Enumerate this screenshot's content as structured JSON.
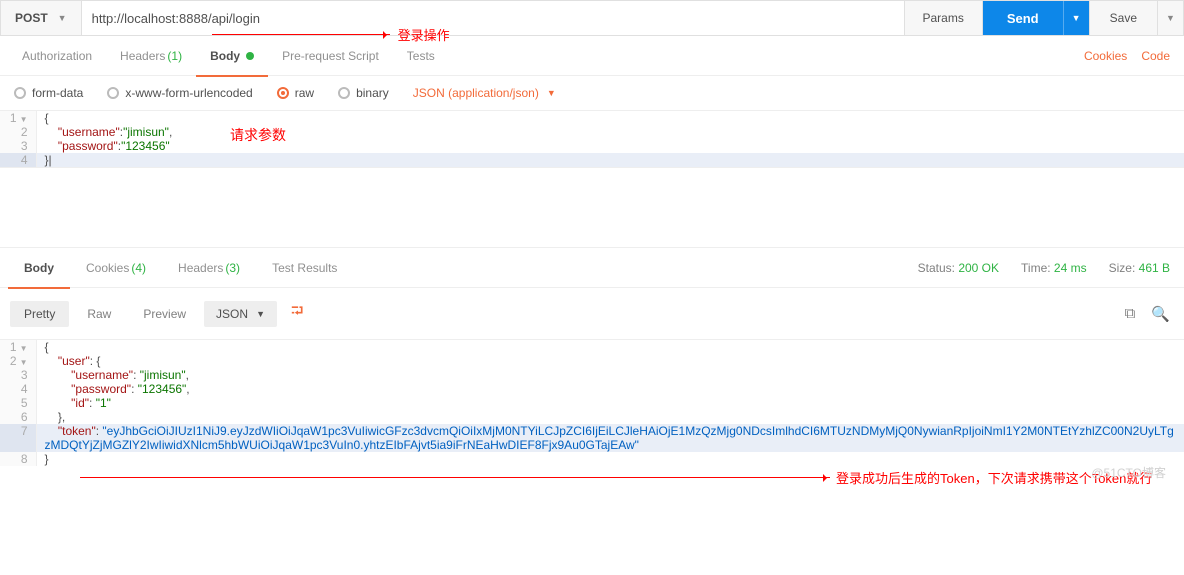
{
  "request": {
    "method": "POST",
    "url": "http://localhost:8888/api/login",
    "params_btn": "Params",
    "send_btn": "Send",
    "save_btn": "Save"
  },
  "req_tabs": {
    "auth": "Authorization",
    "headers": "Headers",
    "headers_count": "(1)",
    "body": "Body",
    "prs": "Pre-request Script",
    "tests": "Tests"
  },
  "right_links": {
    "cookies": "Cookies",
    "code": "Code"
  },
  "body_types": {
    "form": "form-data",
    "urlenc": "x-www-form-urlencoded",
    "raw": "raw",
    "binary": "binary",
    "json_dd": "JSON (application/json)"
  },
  "req_body": {
    "lines": [
      "{",
      "    \"username\":\"jimisun\",",
      "    \"password\":\"123456\"",
      "}"
    ],
    "line1": "{",
    "line2_key": "\"username\"",
    "line2_val": "\"jimisun\"",
    "line2_suffix": ",",
    "line3_key": "\"password\"",
    "line3_val": "\"123456\"",
    "line4": "}"
  },
  "annotations": {
    "login": "登录操作",
    "params": "请求参数",
    "token": "登录成功后生成的Token，下次请求携带这个Token就行"
  },
  "resp_tabs": {
    "body": "Body",
    "cookies": "Cookies",
    "cookies_count": "(4)",
    "headers": "Headers",
    "headers_count": "(3)",
    "tests": "Test Results"
  },
  "status": {
    "status_label": "Status:",
    "status_val": "200 OK",
    "time_label": "Time:",
    "time_val": "24 ms",
    "size_label": "Size:",
    "size_val": "461 B"
  },
  "toolbar": {
    "pretty": "Pretty",
    "raw": "Raw",
    "preview": "Preview",
    "json": "JSON"
  },
  "resp_body": {
    "line1": "{",
    "line2_key": "\"user\"",
    "line2_rest": ": {",
    "line3_key": "\"username\"",
    "line3_val": "\"jimisun\"",
    "comma": ",",
    "line4_key": "\"password\"",
    "line4_val": "\"123456\"",
    "line5_key": "\"id\"",
    "line5_val": "\"1\"",
    "line6": "},",
    "line7_key": "\"token\"",
    "line7_colon": ": ",
    "line7_val": "\"eyJhbGciOiJIUzI1NiJ9.eyJzdWIiOiJqaW1pc3VuIiwicGFzc3dvcmQiOiIxMjM0NTYiLCJpZCI6IjEiLCJleHAiOjE1MzQzMjg0NDcsImlhdCI6MTUzNDMyMjQ0NywianRpIjoiNmI1Y2M0NTEtYzhlZC00N2UyLTgzMDQtYjZjMGZlY2IwIiwidXNlcm5hbWUiOiJqaW1pc3VuIn0.yhtzEIbFAjvt5ia9iFrNEaHwDIEF8Fjx9Au0GTajEAw\"",
    "line8": "}"
  },
  "chart_data": {
    "request_body_json": {
      "username": "jimisun",
      "password": "123456"
    },
    "response_body_json": {
      "user": {
        "username": "jimisun",
        "password": "123456",
        "id": "1"
      },
      "token": "eyJhbGciOiJIUzI1NiJ9.eyJzdWIiOiJqaW1pc3VuIiwicGFzc3dvcmQiOiIxMjM0NTYiLCJpZCI6IjEiLCJleHAiOjE1MzQzMjg0NDcsImlhdCI6MTUzNDMyMjQ0NywianRpIjoiNmI1Y2M0NTEtYzhlZC00N2UyLTgzMDQtYjZjMGZlY2IwIiwidXNlcm5hbWUiOiJqaW1pc3VuIn0.yhtzEIbFAjvt5ia9iFrNEaHwDIEF8Fjx9Au0GTajEAw"
    }
  },
  "watermark": "@51CTO博客"
}
